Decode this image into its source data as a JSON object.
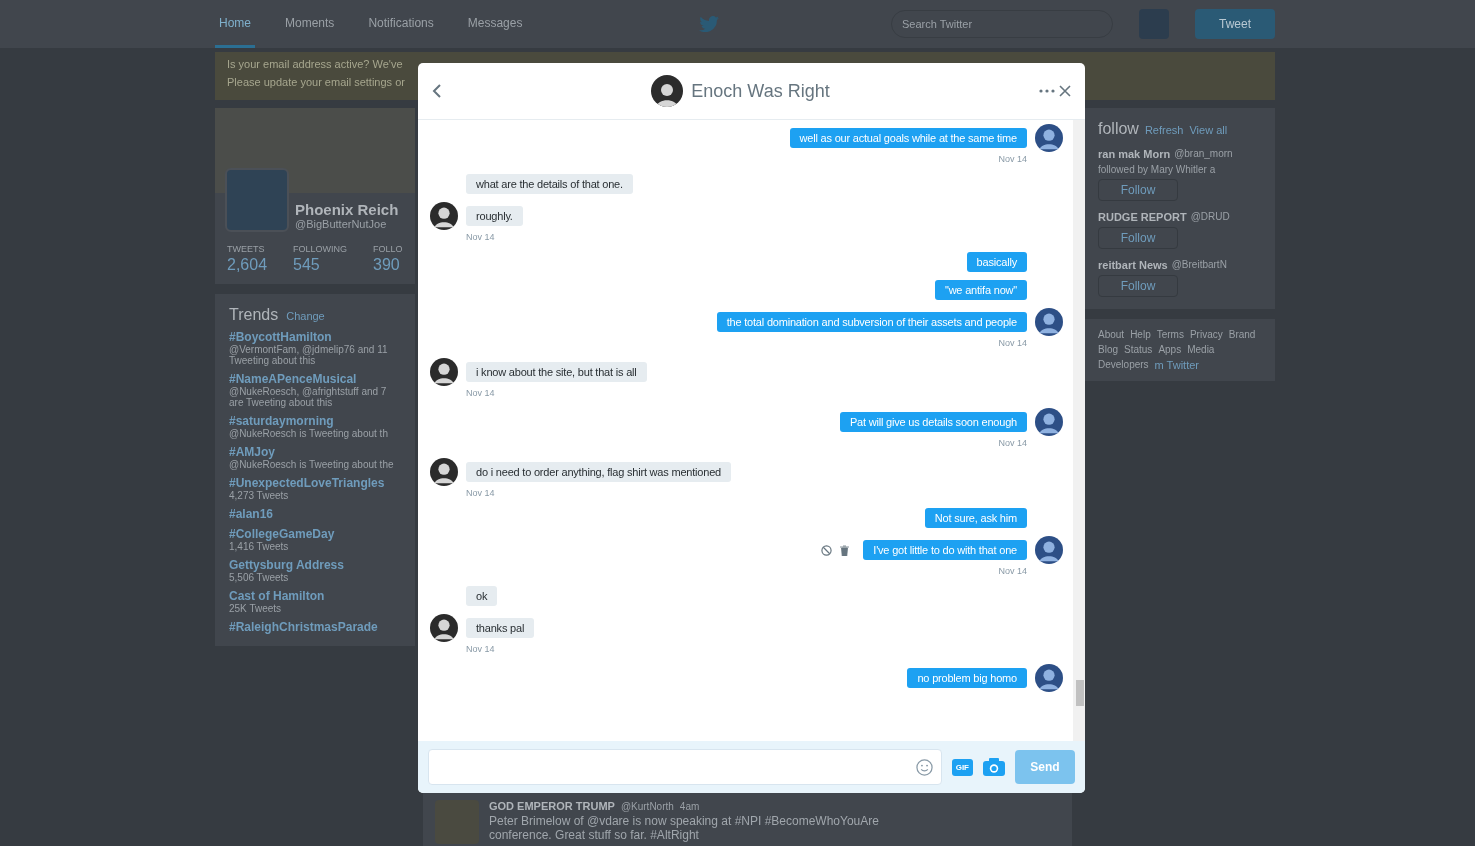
{
  "nav": {
    "tabs": [
      {
        "label": "Home",
        "selected": true
      },
      {
        "label": "Moments",
        "selected": false
      },
      {
        "label": "Notifications",
        "selected": false
      },
      {
        "label": "Messages",
        "selected": false
      }
    ],
    "search": {
      "placeholder": "Search Twitter"
    },
    "tweet_button": "Tweet"
  },
  "banner": {
    "lines": [
      "Is your email address active? We've",
      "Please update your email settings or"
    ]
  },
  "profile": {
    "name": "Phoenix Reich",
    "handle": "@BigButterNutJoe",
    "stats": [
      {
        "label": "TWEETS",
        "value": "2,604"
      },
      {
        "label": "FOLLOWING",
        "value": "545"
      },
      {
        "label": "FOLLO",
        "value": "390"
      }
    ]
  },
  "trends": {
    "title": "Trends",
    "change": "Change",
    "items": [
      {
        "name": "#BoycottHamilton",
        "detail": "@VermontFam, @jdmelip76 and 11 Tweeting about this"
      },
      {
        "name": "#NameAPenceMusical",
        "detail": "@NukeRoesch, @afrightstuff and 7 are Tweeting about this"
      },
      {
        "name": "#saturdaymorning",
        "detail": "@NukeRoesch is Tweeting about th"
      },
      {
        "name": "#AMJoy",
        "detail": "@NukeRoesch is Tweeting about the"
      },
      {
        "name": "#UnexpectedLoveTriangles",
        "detail": "4,273 Tweets"
      },
      {
        "name": "#alan16"
      },
      {
        "name": "#CollegeGameDay",
        "detail": "1,416 Tweets"
      },
      {
        "name": "Gettysburg Address",
        "detail": "5,506 Tweets"
      },
      {
        "name": "Cast of Hamilton",
        "detail": "25K Tweets"
      },
      {
        "name": "#RaleighChristmasParade"
      }
    ]
  },
  "who_to_follow": {
    "title": "follow",
    "links": [
      "Refresh",
      "View all"
    ],
    "accounts": [
      {
        "name": "ran mak Morn",
        "handle": "@bran_morn",
        "context": "followed by Mary Whitler a",
        "follow_label": "Follow"
      },
      {
        "name": "RUDGE REPORT",
        "handle": "@DRUD",
        "follow_label": "Follow"
      },
      {
        "name": "reitbart News",
        "handle": "@BreitbartN",
        "follow_label": "Follow"
      }
    ],
    "footer": [
      "About",
      "Help",
      "Terms",
      "Privacy",
      "Brand",
      "Blog",
      "Status",
      "Apps",
      "Media",
      "Developers"
    ],
    "copyright": "m Twitter"
  },
  "bottom_tweet": {
    "name": "GOD EMPEROR TRUMP",
    "handle": "@KurtNorth",
    "time": "4am",
    "text": "Peter Brimelow of @vdare is now speaking at #NPI #BecomeWhoYouAre conference. Great stuff so far. #AltRight"
  },
  "dialog": {
    "title": "Enoch Was Right",
    "groups": [
      {
        "kind": "sent",
        "time": "Nov 14",
        "messages": [
          {
            "text": "well as our actual goals while at the same time",
            "show_actions": false
          }
        ]
      },
      {
        "kind": "received",
        "time": "Nov 14",
        "messages": [
          {
            "text": "what are the details of that one.",
            "show_actions": false
          },
          {
            "text": "roughly.",
            "show_actions": false
          }
        ]
      },
      {
        "kind": "sent",
        "time": "Nov 14",
        "messages": [
          {
            "text": "basically",
            "show_actions": false
          },
          {
            "text": "\"we antifa now\"",
            "show_actions": false
          },
          {
            "text": "the total domination and subversion of their assets and people",
            "show_actions": false
          }
        ]
      },
      {
        "kind": "received",
        "time": "Nov 14",
        "messages": [
          {
            "text": "i know about the site, but that is all",
            "show_actions": false
          }
        ]
      },
      {
        "kind": "sent",
        "time": "Nov 14",
        "messages": [
          {
            "text": "Pat will give us details soon enough",
            "show_actions": false
          }
        ]
      },
      {
        "kind": "received",
        "time": "Nov 14",
        "messages": [
          {
            "text": "do i need to order anything, flag shirt was mentioned",
            "show_actions": false
          }
        ]
      },
      {
        "kind": "sent",
        "time": "Nov 14",
        "messages": [
          {
            "text": "Not sure, ask him",
            "show_actions": false
          },
          {
            "text": "I've got little to do with that one",
            "show_actions": true
          }
        ]
      },
      {
        "kind": "received",
        "time": "Nov 14",
        "messages": [
          {
            "text": "ok",
            "show_actions": false
          },
          {
            "text": "thanks pal",
            "show_actions": false
          }
        ]
      },
      {
        "kind": "sent",
        "messages": [
          {
            "text": "no problem big homo",
            "show_actions": false
          }
        ]
      }
    ],
    "composer": {
      "gif_label": "GIF",
      "send": {
        "label": "Send",
        "disabled": true
      }
    }
  }
}
